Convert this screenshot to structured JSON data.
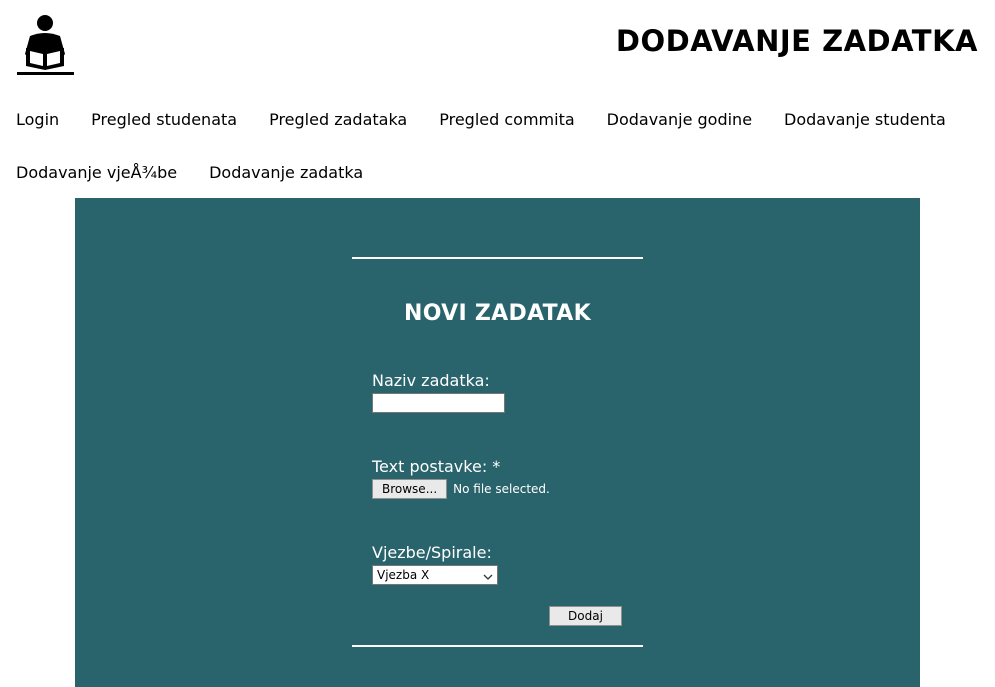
{
  "header": {
    "logo_icon": "reading-person-icon",
    "title": "DODAVANJE ZADATKA"
  },
  "nav": {
    "row1": [
      "Login",
      "Pregled studenata",
      "Pregled zadataka",
      "Pregled commita",
      "Dodavanje godine",
      "Dodavanje studenta"
    ],
    "row2": [
      "Dodavanje vjeÅ¾be",
      "Dodavanje zadatka"
    ]
  },
  "form": {
    "title": "NOVI ZADATAK",
    "naziv_label": "Naziv zadatka:",
    "naziv_value": "",
    "text_label": "Text postavke: *",
    "browse_label": "Browse...",
    "file_status": "No file selected.",
    "vjezbe_label": "Vjezbe/Spirale:",
    "vjezbe_selected": "Vjezba X",
    "submit_label": "Dodaj"
  },
  "colors": {
    "panel_background": "#29636b",
    "text_on_panel": "#ffffff"
  }
}
